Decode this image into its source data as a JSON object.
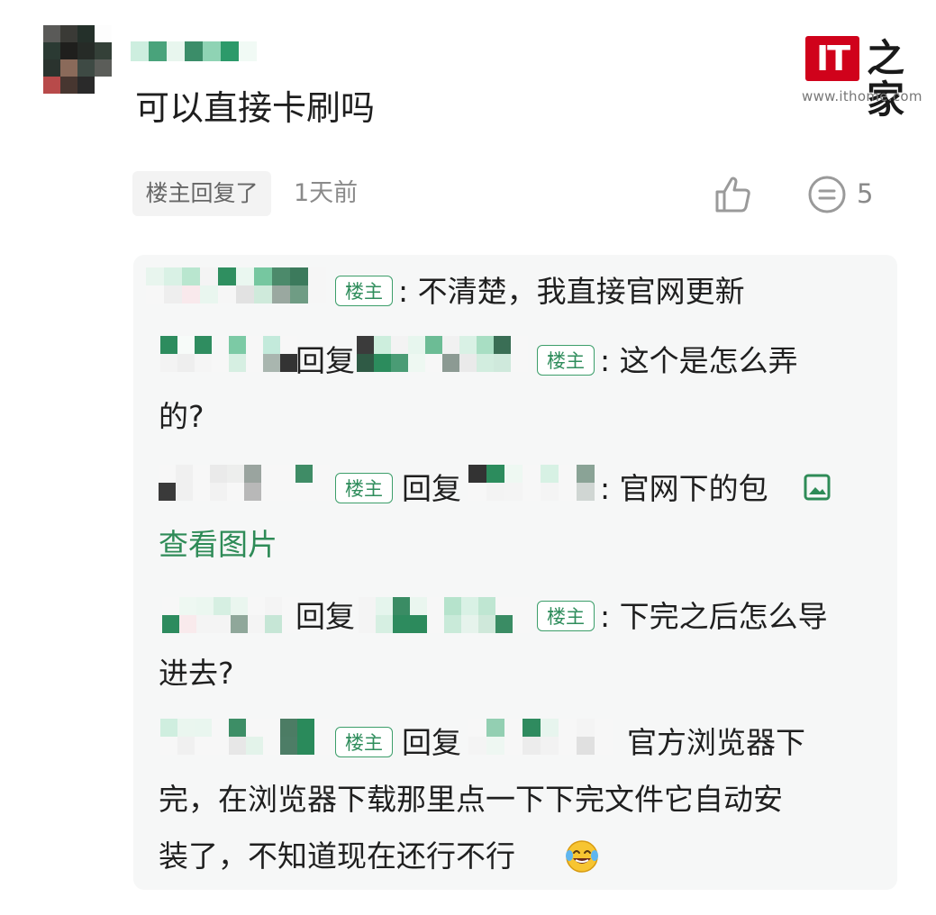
{
  "post": {
    "comment_text": "可以直接卡刷吗",
    "reply_tag": "楼主回复了",
    "time": "1天前",
    "comment_count": "5"
  },
  "logo": {
    "it": "IT",
    "cn": "之家",
    "url": "www.ithome.com"
  },
  "icons": {
    "like": "thumbs-up-icon",
    "comment": "comment-bubble-icon",
    "image": "image-icon",
    "emoji": "laugh-tears-emoji-icon"
  },
  "replies": {
    "r1": {
      "badge": "楼主",
      "text": ": 不清楚，我直接官网更新"
    },
    "r2": {
      "reply_word": "回复",
      "badge": "楼主",
      "text1": ": 这个是怎么弄",
      "text2": "的?"
    },
    "r3": {
      "badge": "楼主",
      "reply_word": "回复",
      "text1": ": 官网下的包",
      "view_image": "查看图片"
    },
    "r4": {
      "reply_word": "回复",
      "badge": "楼主",
      "text1": ": 下完之后怎么导",
      "text2": "进去?"
    },
    "r5": {
      "badge": "楼主",
      "reply_word": "回复",
      "text1": "官方浏览器下",
      "text2": "完，在浏览器下载那里点一下下完文件它自动安",
      "text3": "装了，不知道现在还行不行"
    }
  },
  "colors": {
    "accent_green": "#2e8b57",
    "logo_red": "#d0021b",
    "panel_bg": "#f6f7f7"
  }
}
